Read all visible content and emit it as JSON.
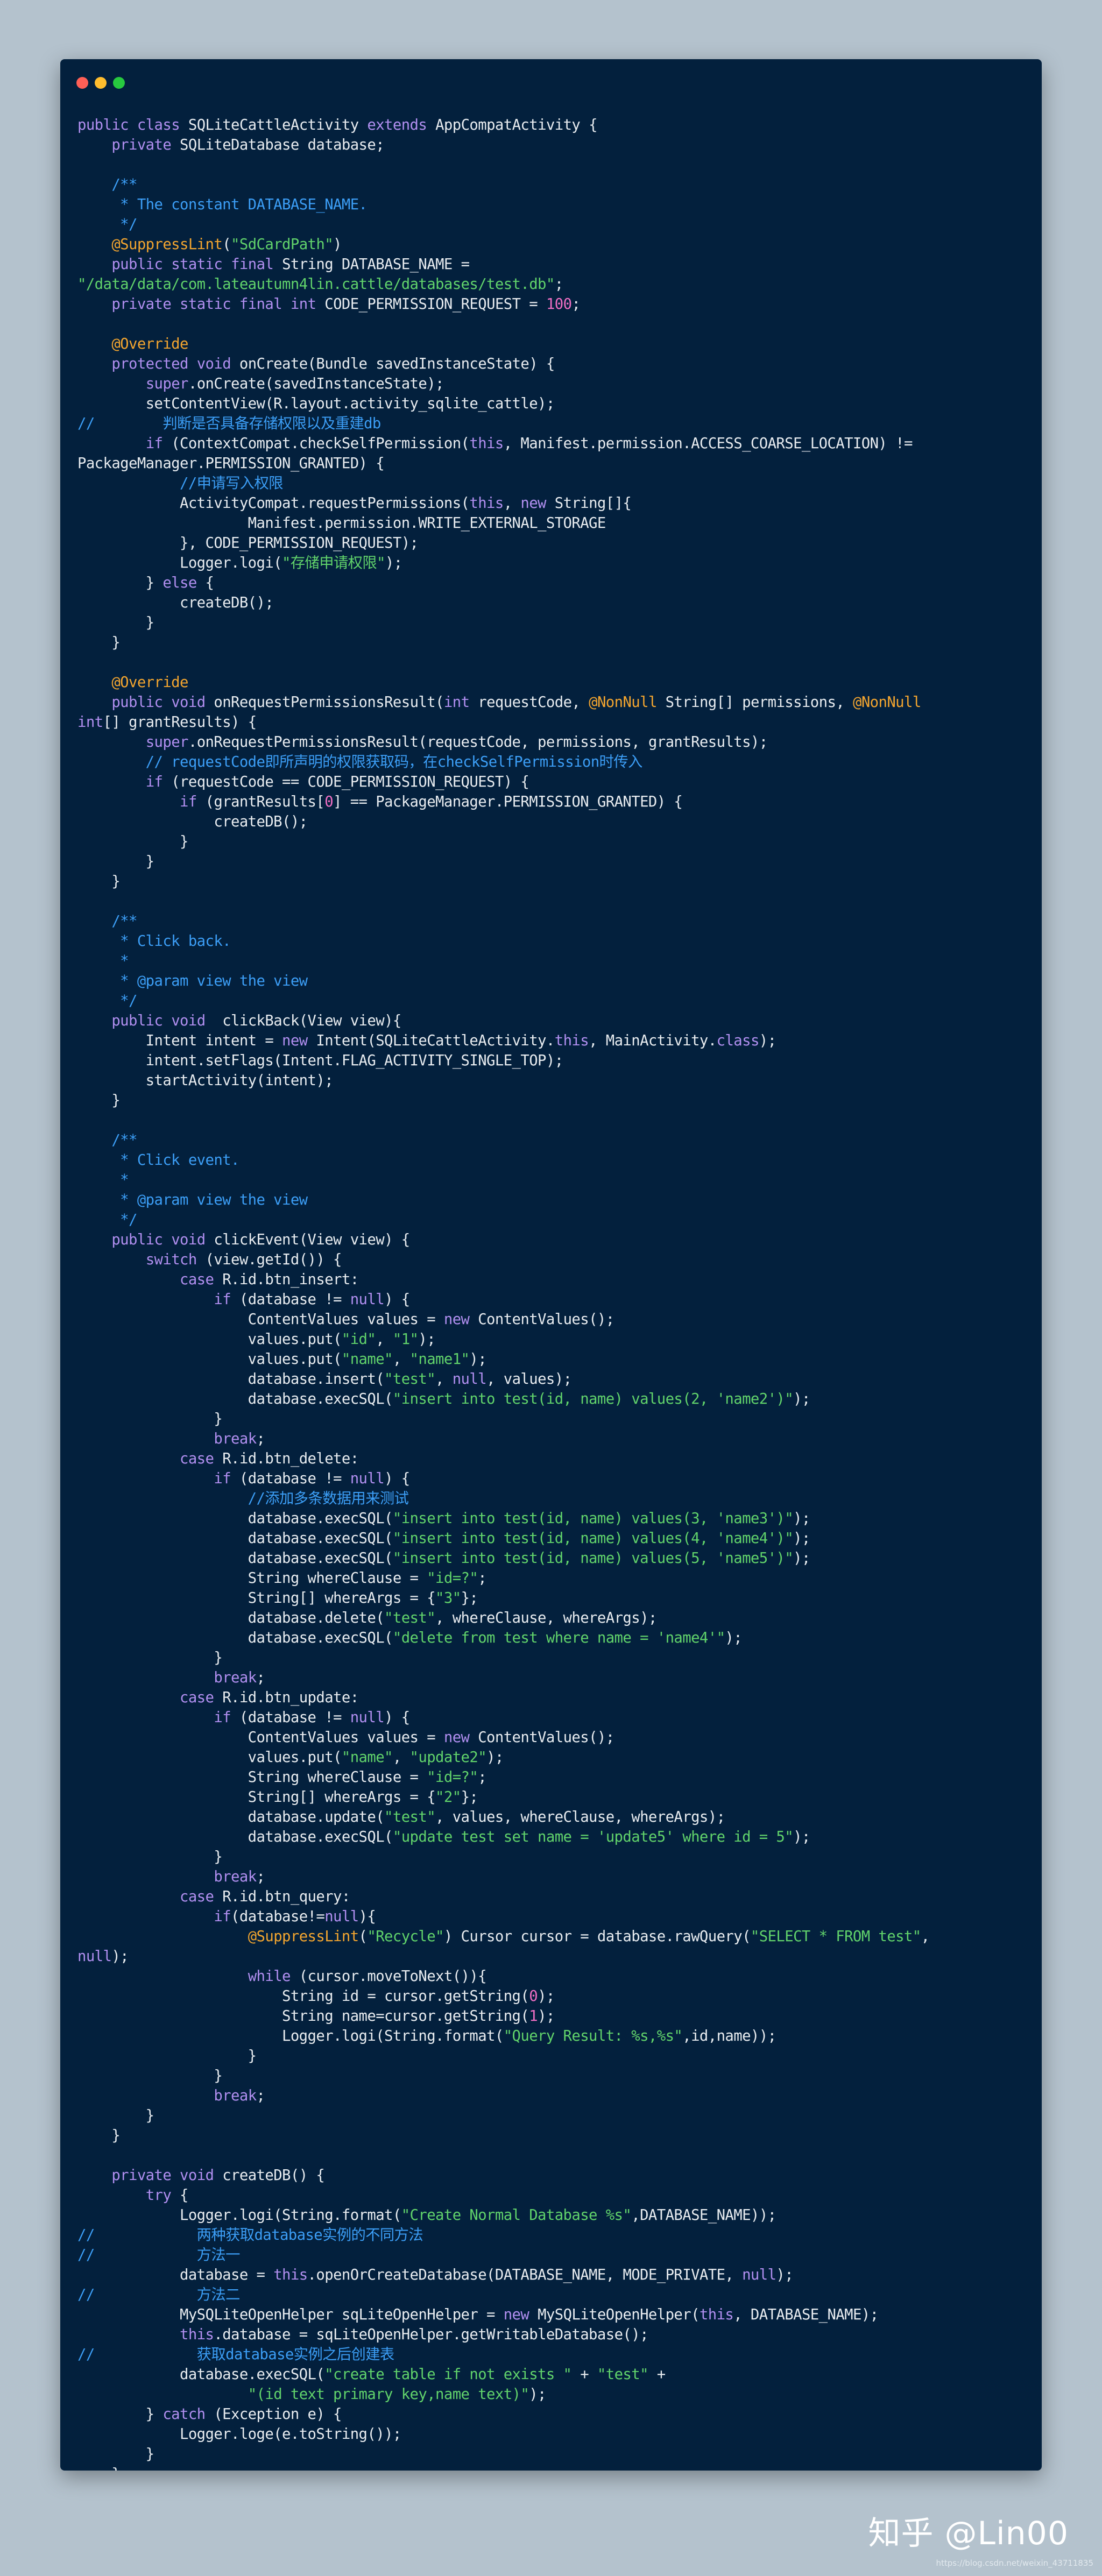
{
  "window": {
    "controls": [
      "close",
      "minimize",
      "maximize"
    ],
    "control_colors": {
      "close": "#ff5f56",
      "minimize": "#ffbd2e",
      "maximize": "#27c93f"
    }
  },
  "colors": {
    "background": "#b4c2cd",
    "window": "#03203d",
    "keyword": "#b18ff0",
    "type": "#f4d87b",
    "string": "#61d36b",
    "number": "#f06fc4",
    "comment": "#3c9ef6",
    "annotation": "#f3a52f"
  },
  "code_lines": [
    "public class SQLiteCattleActivity extends AppCompatActivity {",
    "    private SQLiteDatabase database;",
    "",
    "    /**",
    "     * The constant DATABASE_NAME.",
    "     */",
    "    @SuppressLint(\"SdCardPath\")",
    "    public static final String DATABASE_NAME =",
    "\"/data/data/com.lateautumn4lin.cattle/databases/test.db\";",
    "    private static final int CODE_PERMISSION_REQUEST = 100;",
    "",
    "    @Override",
    "    protected void onCreate(Bundle savedInstanceState) {",
    "        super.onCreate(savedInstanceState);",
    "        setContentView(R.layout.activity_sqlite_cattle);",
    "//        判断是否具备存储权限以及重建db",
    "        if (ContextCompat.checkSelfPermission(this, Manifest.permission.ACCESS_COARSE_LOCATION) !=",
    "PackageManager.PERMISSION_GRANTED) {",
    "            //申请写入权限",
    "            ActivityCompat.requestPermissions(this, new String[]{",
    "                    Manifest.permission.WRITE_EXTERNAL_STORAGE",
    "            }, CODE_PERMISSION_REQUEST);",
    "            Logger.logi(\"存储申请权限\");",
    "        } else {",
    "            createDB();",
    "        }",
    "    }",
    "",
    "    @Override",
    "    public void onRequestPermissionsResult(int requestCode, @NonNull String[] permissions, @NonNull",
    "int[] grantResults) {",
    "        super.onRequestPermissionsResult(requestCode, permissions, grantResults);",
    "        // requestCode即所声明的权限获取码，在checkSelfPermission时传入",
    "        if (requestCode == CODE_PERMISSION_REQUEST) {",
    "            if (grantResults[0] == PackageManager.PERMISSION_GRANTED) {",
    "                createDB();",
    "            }",
    "        }",
    "    }",
    "",
    "    /**",
    "     * Click back.",
    "     *",
    "     * @param view the view",
    "     */",
    "    public void  clickBack(View view){",
    "        Intent intent = new Intent(SQLiteCattleActivity.this, MainActivity.class);",
    "        intent.setFlags(Intent.FLAG_ACTIVITY_SINGLE_TOP);",
    "        startActivity(intent);",
    "    }",
    "",
    "    /**",
    "     * Click event.",
    "     *",
    "     * @param view the view",
    "     */",
    "    public void clickEvent(View view) {",
    "        switch (view.getId()) {",
    "            case R.id.btn_insert:",
    "                if (database != null) {",
    "                    ContentValues values = new ContentValues();",
    "                    values.put(\"id\", \"1\");",
    "                    values.put(\"name\", \"name1\");",
    "                    database.insert(\"test\", null, values);",
    "                    database.execSQL(\"insert into test(id, name) values(2, 'name2')\");",
    "                }",
    "                break;",
    "            case R.id.btn_delete:",
    "                if (database != null) {",
    "                    //添加多条数据用来测试",
    "                    database.execSQL(\"insert into test(id, name) values(3, 'name3')\");",
    "                    database.execSQL(\"insert into test(id, name) values(4, 'name4')\");",
    "                    database.execSQL(\"insert into test(id, name) values(5, 'name5')\");",
    "                    String whereClause = \"id=?\";",
    "                    String[] whereArgs = {\"3\"};",
    "                    database.delete(\"test\", whereClause, whereArgs);",
    "                    database.execSQL(\"delete from test where name = 'name4'\");",
    "                }",
    "                break;",
    "            case R.id.btn_update:",
    "                if (database != null) {",
    "                    ContentValues values = new ContentValues();",
    "                    values.put(\"name\", \"update2\");",
    "                    String whereClause = \"id=?\";",
    "                    String[] whereArgs = {\"2\"};",
    "                    database.update(\"test\", values, whereClause, whereArgs);",
    "                    database.execSQL(\"update test set name = 'update5' where id = 5\");",
    "                }",
    "                break;",
    "            case R.id.btn_query:",
    "                if(database!=null){",
    "                    @SuppressLint(\"Recycle\") Cursor cursor = database.rawQuery(\"SELECT * FROM test\",",
    "null);",
    "                    while (cursor.moveToNext()){",
    "                        String id = cursor.getString(0);",
    "                        String name=cursor.getString(1);",
    "                        Logger.logi(String.format(\"Query Result: %s,%s\",id,name));",
    "                    }",
    "                }",
    "                break;",
    "        }",
    "    }",
    "",
    "    private void createDB() {",
    "        try {",
    "            Logger.logi(String.format(\"Create Normal Database %s\",DATABASE_NAME));",
    "//            两种获取database实例的不同方法",
    "//            方法一",
    "            database = this.openOrCreateDatabase(DATABASE_NAME, MODE_PRIVATE, null);",
    "//            方法二",
    "            MySQLiteOpenHelper sqLiteOpenHelper = new MySQLiteOpenHelper(this, DATABASE_NAME);",
    "            this.database = sqLiteOpenHelper.getWritableDatabase();",
    "//            获取database实例之后创建表",
    "            database.execSQL(\"create table if not exists \" + \"test\" +",
    "                    \"(id text primary key,name text)\");",
    "        } catch (Exception e) {",
    "            Logger.loge(e.toString());",
    "        }",
    "    }",
    "}"
  ],
  "watermark": "知乎 @Lin00",
  "source_url": "https://blog.csdn.net/weixin_43711835"
}
